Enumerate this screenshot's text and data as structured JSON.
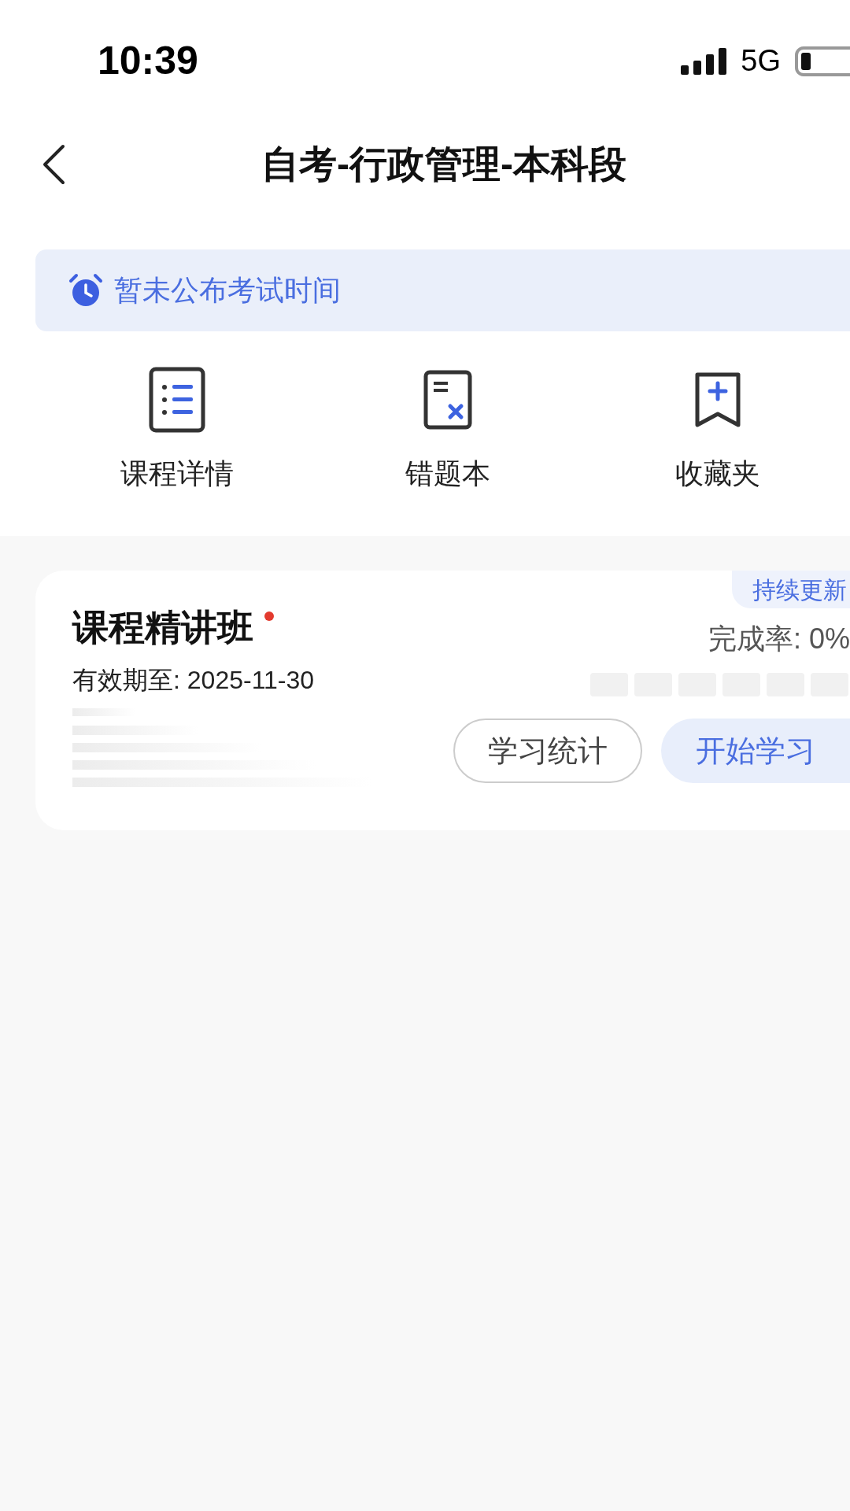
{
  "status_bar": {
    "time": "10:39",
    "network": "5G"
  },
  "nav": {
    "title": "自考-行政管理-本科段"
  },
  "notice": {
    "text": "暂未公布考试时间"
  },
  "shortcuts": [
    {
      "kind": "list",
      "label": "课程详情"
    },
    {
      "kind": "mistakes",
      "label": "错题本"
    },
    {
      "kind": "bookmark",
      "label": "收藏夹"
    }
  ],
  "course_card": {
    "tag": "持续更新",
    "title": "课程精讲班",
    "unread": true,
    "validity": "有效期至: 2025-11-30",
    "completion": "完成率: 0%",
    "buttons": [
      {
        "kind": "outline",
        "label": "学习统计"
      },
      {
        "kind": "primary",
        "label": "开始学习"
      }
    ]
  }
}
